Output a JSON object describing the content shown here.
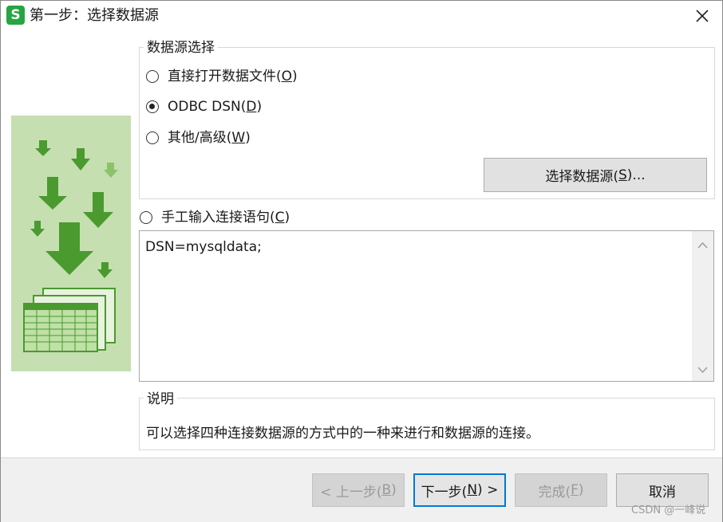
{
  "window": {
    "title": "第一步：选择数据源",
    "app_icon_letter": "S"
  },
  "data_source_group": {
    "legend": "数据源选择",
    "options": [
      {
        "label": "直接打开数据文件(",
        "key": "O",
        "suffix": ")",
        "checked": false
      },
      {
        "label": "ODBC DSN(",
        "key": "D",
        "suffix": ")",
        "checked": true
      },
      {
        "label": "其他/高级(",
        "key": "W",
        "suffix": ")",
        "checked": false
      }
    ],
    "select_button": {
      "label": "选择数据源(",
      "key": "S",
      "suffix": ")..."
    }
  },
  "manual_connection": {
    "label": "手工输入连接语句(",
    "key": "C",
    "suffix": ")",
    "checked": false,
    "text": "DSN=mysqldata;"
  },
  "description_group": {
    "legend": "说明",
    "text": "可以选择四种连接数据源的方式中的一种来进行和数据源的连接。"
  },
  "footer_buttons": {
    "prev": {
      "label": "< 上一步(",
      "key": "B",
      "suffix": ")",
      "enabled": false
    },
    "next": {
      "label": "下一步(",
      "key": "N",
      "suffix": ") >",
      "enabled": true
    },
    "finish": {
      "label": "完成(",
      "key": "F",
      "suffix": ")",
      "enabled": false
    },
    "cancel": {
      "label": "取消",
      "enabled": true
    }
  },
  "watermark": "CSDN @一峰说",
  "colors": {
    "accent_focus": "#0078d7",
    "app_icon": "#27a443",
    "illustration_bg": "#c5dfb1",
    "illustration_dark": "#4a9a2f",
    "illustration_light": "#8cc26a"
  }
}
